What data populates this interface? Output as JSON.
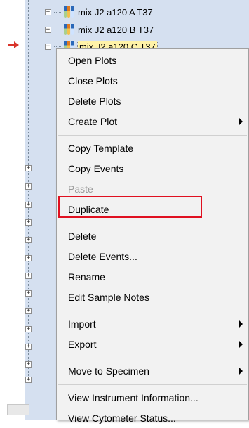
{
  "tree": {
    "rows": [
      {
        "label": "mix J2 a120 A T37",
        "selected": false
      },
      {
        "label": "mix J2 a120 B T37",
        "selected": false
      },
      {
        "label": "mix J2 a120 C T37",
        "selected": true
      }
    ]
  },
  "context_menu": {
    "groups": [
      [
        {
          "label": "Open Plots",
          "enabled": true,
          "submenu": false
        },
        {
          "label": "Close Plots",
          "enabled": true,
          "submenu": false
        },
        {
          "label": "Delete Plots",
          "enabled": true,
          "submenu": false
        },
        {
          "label": "Create Plot",
          "enabled": true,
          "submenu": true
        }
      ],
      [
        {
          "label": "Copy Template",
          "enabled": true,
          "submenu": false
        },
        {
          "label": "Copy Events",
          "enabled": true,
          "submenu": false
        },
        {
          "label": "Paste",
          "enabled": false,
          "submenu": false
        },
        {
          "label": "Duplicate",
          "enabled": true,
          "submenu": false,
          "highlighted": true
        }
      ],
      [
        {
          "label": "Delete",
          "enabled": true,
          "submenu": false
        },
        {
          "label": "Delete Events...",
          "enabled": true,
          "submenu": false
        },
        {
          "label": "Rename",
          "enabled": true,
          "submenu": false
        },
        {
          "label": "Edit Sample Notes",
          "enabled": true,
          "submenu": false
        }
      ],
      [
        {
          "label": "Import",
          "enabled": true,
          "submenu": true
        },
        {
          "label": "Export",
          "enabled": true,
          "submenu": true
        }
      ],
      [
        {
          "label": "Move to Specimen",
          "enabled": true,
          "submenu": true
        }
      ],
      [
        {
          "label": "View Instrument Information...",
          "enabled": true,
          "submenu": false
        },
        {
          "label": "View Cytometer Status...",
          "enabled": true,
          "submenu": false
        }
      ]
    ]
  },
  "colors": {
    "tree_background": "#d5e0f0",
    "menu_background": "#f2f2f2",
    "annotation_box": "#e01020",
    "pointer_arrow": "#d9342b",
    "disabled_text": "#9a9a9a"
  },
  "icons": {
    "tube": "tube-sample-icon",
    "pointer": "current-sample-arrow-icon",
    "expander": "expand-plus-icon",
    "submenu": "submenu-arrow-icon"
  }
}
